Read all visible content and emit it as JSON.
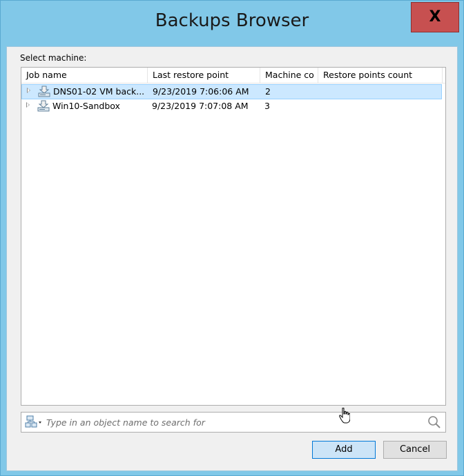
{
  "window": {
    "title": "Backups Browser",
    "close_label": "X"
  },
  "select_label": "Select machine:",
  "columns": [
    "Job name",
    "Last restore point",
    "Machine co",
    "Restore points count"
  ],
  "rows": [
    {
      "job_name": "DNS01-02 VM back...",
      "last_restore_point": "9/23/2019 7:06:06 AM",
      "machine_count": "2",
      "restore_points_count": "",
      "selected": true
    },
    {
      "job_name": "Win10-Sandbox",
      "last_restore_point": "9/23/2019 7:07:08 AM",
      "machine_count": "3",
      "restore_points_count": "",
      "selected": false
    }
  ],
  "search": {
    "placeholder": "Type in an object name to search for",
    "value": ""
  },
  "buttons": {
    "add": "Add",
    "cancel": "Cancel"
  },
  "icons": {
    "job": "backup-job-icon",
    "scope": "scope-dropdown-icon",
    "search": "search-icon"
  },
  "colors": {
    "title_bar": "#81c8e8",
    "close_button": "#c75050",
    "selection": "#cce8ff",
    "default_button": "#cce4f7"
  }
}
